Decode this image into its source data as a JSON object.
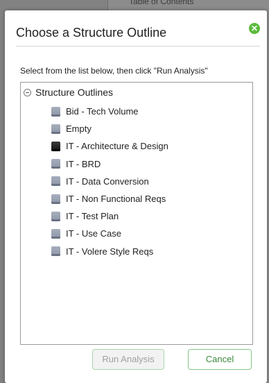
{
  "background": {
    "toc_text": "Table of Contents"
  },
  "dialog": {
    "title": "Choose a Structure Outline",
    "close_glyph": "✕",
    "instructions": "Select from the list below, then click \"Run Analysis\"",
    "tree": {
      "root_label": "Structure Outlines",
      "items": [
        {
          "label": "Bid - Tech Volume",
          "icon": "outline-icon"
        },
        {
          "label": "Empty",
          "icon": "outline-icon"
        },
        {
          "label": "IT - Architecture & Design",
          "icon": "outline-icon-selected"
        },
        {
          "label": "IT - BRD",
          "icon": "outline-icon"
        },
        {
          "label": "IT - Data Conversion",
          "icon": "outline-icon"
        },
        {
          "label": "IT - Non Functional Reqs",
          "icon": "outline-icon"
        },
        {
          "label": "IT - Test Plan",
          "icon": "outline-icon"
        },
        {
          "label": "IT - Use Case",
          "icon": "outline-icon"
        },
        {
          "label": "IT - Volere Style Reqs",
          "icon": "outline-icon"
        }
      ]
    },
    "buttons": {
      "run_label": "Run Analysis",
      "cancel_label": "Cancel"
    },
    "colors": {
      "accent": "#5cba3c",
      "cancel_text": "#3c8a3c",
      "disabled_text": "#a0a0a0"
    }
  }
}
